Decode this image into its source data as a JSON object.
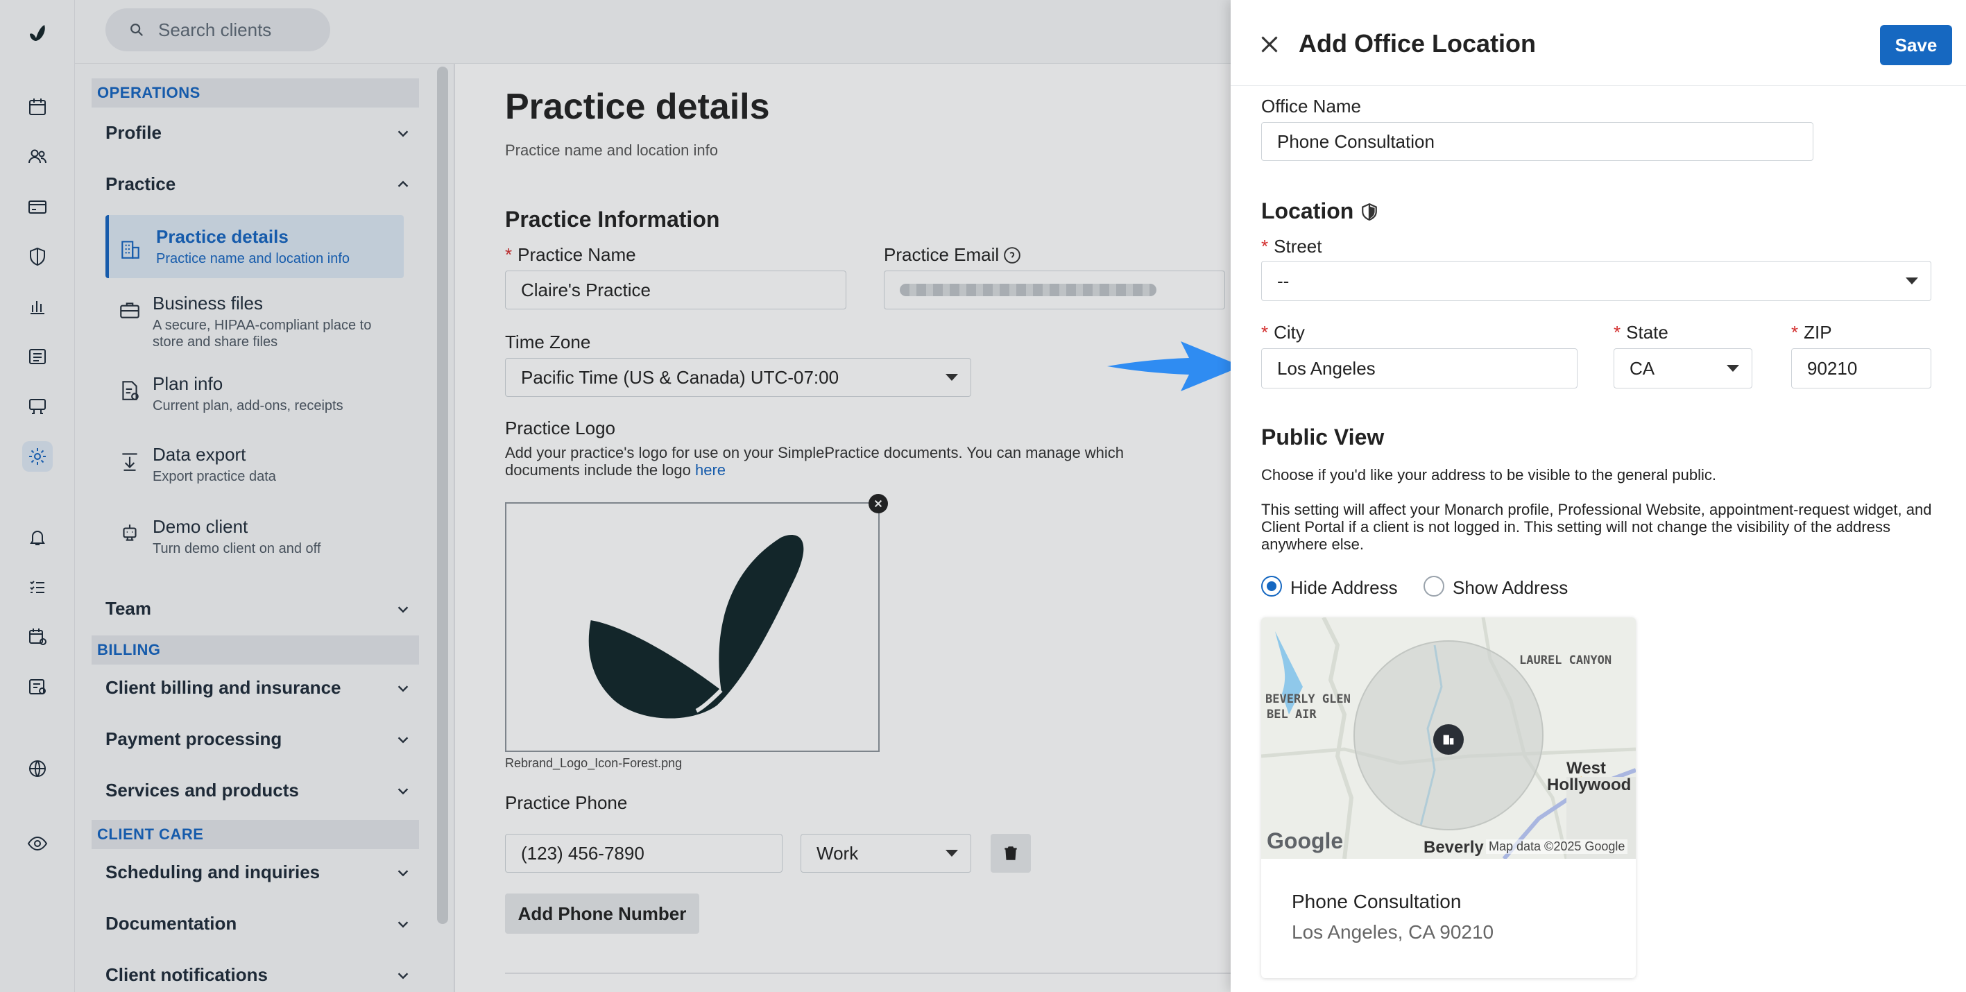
{
  "search": {
    "placeholder": "Search clients"
  },
  "nav": {
    "sections": {
      "operations": "OPERATIONS",
      "billing": "BILLING",
      "client_care": "CLIENT CARE"
    },
    "profile": "Profile",
    "practice": "Practice",
    "practice_items": [
      {
        "title": "Practice details",
        "desc": "Practice name and location info"
      },
      {
        "title": "Business files",
        "desc": "A secure, HIPAA-compliant place to store and share files"
      },
      {
        "title": "Plan info",
        "desc": "Current plan, add-ons, receipts"
      },
      {
        "title": "Data export",
        "desc": "Export practice data"
      },
      {
        "title": "Demo client",
        "desc": "Turn demo client on and off"
      }
    ],
    "team": "Team",
    "billing_items": [
      "Client billing and insurance",
      "Payment processing",
      "Services and products"
    ],
    "care_items": [
      "Scheduling and inquiries",
      "Documentation",
      "Client notifications"
    ]
  },
  "main": {
    "title": "Practice details",
    "subtitle": "Practice name and location info",
    "section_title": "Practice Information",
    "practice_name_label": "Practice Name",
    "practice_name_value": "Claire's Practice",
    "practice_email_label": "Practice Email",
    "timezone_label": "Time Zone",
    "timezone_value": "Pacific Time (US & Canada) UTC-07:00",
    "logo_label": "Practice Logo",
    "logo_help": "Add your practice's logo for use on your SimplePractice documents. You can manage which documents include the logo",
    "logo_help_link": "here",
    "logo_filename": "Rebrand_Logo_Icon-Forest.png",
    "phone_label": "Practice Phone",
    "phone_value": "(123) 456-7890",
    "phone_type": "Work",
    "add_phone_button": "Add Phone Number"
  },
  "drawer": {
    "title": "Add Office Location",
    "save": "Save",
    "office_name_label": "Office Name",
    "office_name_value": "Phone Consultation",
    "location_title": "Location",
    "street_label": "Street",
    "street_value": "--",
    "city_label": "City",
    "city_value": "Los Angeles",
    "state_label": "State",
    "state_value": "CA",
    "zip_label": "ZIP",
    "zip_value": "90210",
    "public_view_title": "Public View",
    "public_view_help1": "Choose if you'd like your address to be visible to the general public.",
    "public_view_help2": "This setting will affect your Monarch profile, Professional Website, appointment-request widget, and Client Portal if a client is not logged in. This setting will not change the visibility of the address anywhere else.",
    "hide_address": "Hide Address",
    "show_address": "Show Address",
    "map": {
      "labels": [
        "LAUREL CANYON",
        "BEVERLY GLEN",
        "BEL AIR",
        "West",
        "Hollywood",
        "Beverly"
      ],
      "google": "Google",
      "map_data": "Map data ©2025 Google"
    },
    "card_title": "Phone Consultation",
    "card_address": "Los Angeles, CA 90210"
  }
}
